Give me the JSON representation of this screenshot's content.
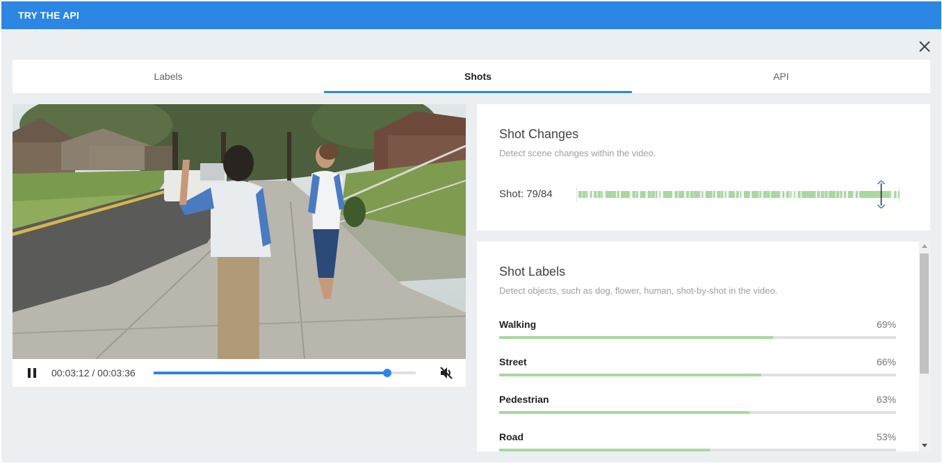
{
  "header": {
    "title": "TRY THE API",
    "color": "#2b86e4"
  },
  "dialog": {
    "close_icon": "close-icon"
  },
  "tabs": [
    {
      "label": "Labels",
      "active": false
    },
    {
      "label": "Shots",
      "active": true
    },
    {
      "label": "API",
      "active": false
    }
  ],
  "player": {
    "time": "00:03:12 / 00:03:36",
    "progress_fraction": 0.89,
    "pause_icon": "pause-icon",
    "mute_icon": "volume-muted-icon"
  },
  "shot_changes": {
    "title": "Shot Changes",
    "subtitle": "Detect scene changes within the video.",
    "shot_label": "Shot: 79/84",
    "current_shot": 79,
    "total_shots": 84,
    "marker_color": "#a8d8a0"
  },
  "shot_labels": {
    "title": "Shot Labels",
    "subtitle": "Detect objects, such as dog, flower, human, shot-by-shot in the video.",
    "bar_color": "#a8d8a0",
    "items": [
      {
        "name": "Walking",
        "percent": "69%",
        "value": 0.69
      },
      {
        "name": "Street",
        "percent": "66%",
        "value": 0.66
      },
      {
        "name": "Pedestrian",
        "percent": "63%",
        "value": 0.63
      },
      {
        "name": "Road",
        "percent": "53%",
        "value": 0.53
      }
    ]
  }
}
